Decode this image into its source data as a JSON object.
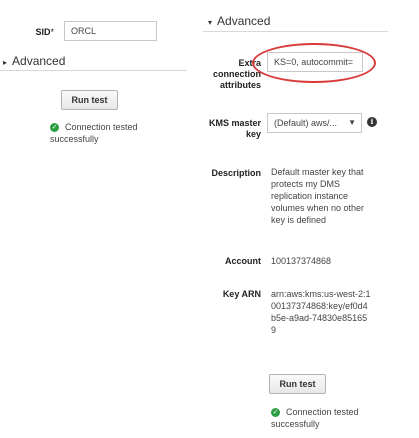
{
  "left": {
    "sid_label": "SID",
    "required_mark": "*",
    "sid_value": "ORCL",
    "advanced_label": "Advanced",
    "run_test_label": "Run test",
    "status_text": "Connection tested successfully"
  },
  "right": {
    "advanced_label": "Advanced",
    "extra_label": "Extra connection attributes",
    "extra_value": "KS=0, autocommit=",
    "kms_label": "KMS master key",
    "kms_value": "(Default) aws/...",
    "info_icon_glyph": "i",
    "description_label": "Description",
    "description_text": "Default master key that protects my DMS replication instance volumes when no other key is defined",
    "account_label": "Account",
    "account_value": "100137374868",
    "key_arn_label": "Key ARN",
    "key_arn_value": "arn:aws:kms:us-west-2:100137374868:key/ef0d4b5e-a9ad-74830e851659",
    "run_test_label": "Run test",
    "status_text": "Connection tested successfully"
  },
  "colors": {
    "highlight_ring": "#d93a3a",
    "success_icon": "#2e9e44"
  },
  "icons": {
    "caret_down": "caret-down-icon",
    "caret_right": "caret-right-icon",
    "dropdown": "dropdown-arrow-icon",
    "info": "info-icon",
    "success": "success-check-icon"
  }
}
